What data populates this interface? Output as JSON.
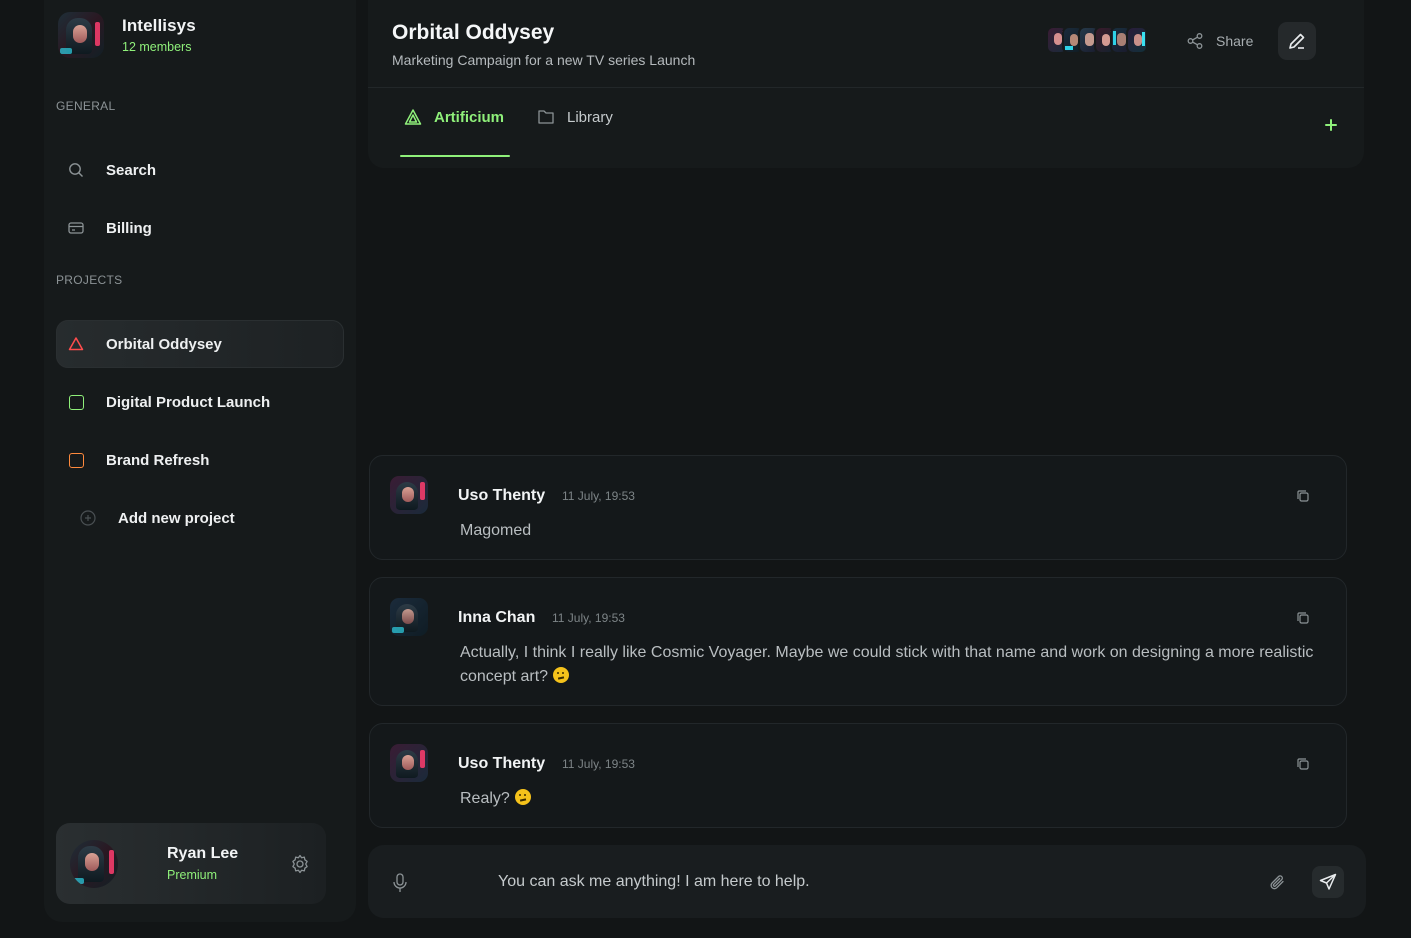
{
  "workspace": {
    "name": "Intellisys",
    "members": "12 members"
  },
  "sidebar": {
    "general_label": "GENERAL",
    "general_items": [
      {
        "label": "Search",
        "icon": "search-icon"
      },
      {
        "label": "Billing",
        "icon": "billing-icon"
      }
    ],
    "projects_label": "PROJECTS",
    "projects": [
      {
        "label": "Orbital Oddysey",
        "color": "#ff4d4d",
        "active": true
      },
      {
        "label": "Digital Product Launch",
        "color": "#8ff07a",
        "active": false
      },
      {
        "label": "Brand Refresh",
        "color": "#ff8a3d",
        "active": false
      }
    ],
    "add_project": "Add new project"
  },
  "user": {
    "name": "Ryan Lee",
    "plan": "Premium"
  },
  "header": {
    "title": "Orbital Oddysey",
    "subtitle": "Marketing Campaign for a new TV series Launch",
    "share_label": "Share",
    "tabs": [
      {
        "label": "Artificium",
        "active": true
      },
      {
        "label": "Library",
        "active": false
      }
    ]
  },
  "messages": [
    {
      "author": "Uso Thenty",
      "time": "11 July, 19:53",
      "text": "Magomed",
      "emoji": false
    },
    {
      "author": "Inna Chan",
      "time": "11 July, 19:53",
      "text": "Actually, I think I really like Cosmic Voyager. Maybe we could stick with that name and work on designing a more realistic concept art?",
      "emoji": true
    },
    {
      "author": "Uso Thenty",
      "time": "11 July, 19:53",
      "text": "Realy?",
      "emoji": true
    }
  ],
  "composer": {
    "placeholder": "You can ask me anything! I am here to help."
  },
  "colors": {
    "accent": "#8ff07a",
    "background": "#121516",
    "panel": "#161a1b"
  }
}
